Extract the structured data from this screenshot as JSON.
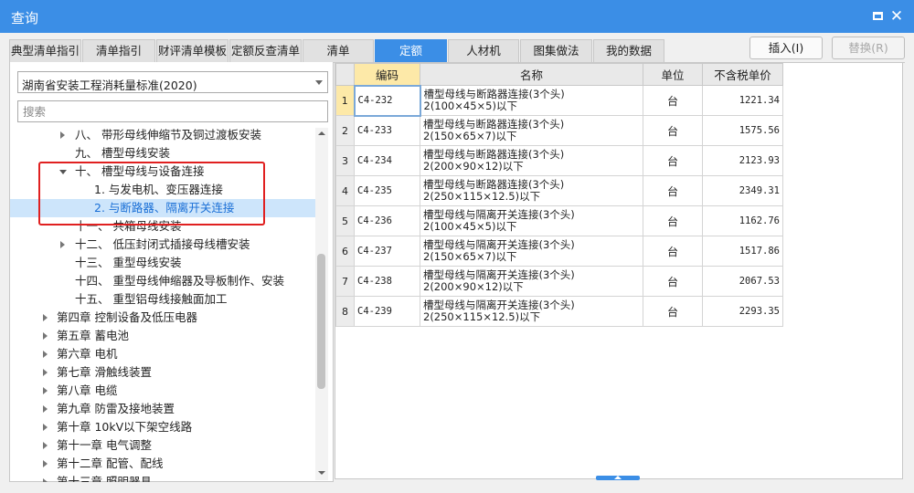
{
  "window": {
    "title": "查询"
  },
  "tabs": [
    {
      "label": "典型清单指引",
      "active": false
    },
    {
      "label": "清单指引",
      "active": false
    },
    {
      "label": "财评清单模板",
      "active": false
    },
    {
      "label": "定额反查清单",
      "active": false
    },
    {
      "label": "清单",
      "active": false
    },
    {
      "label": "定额",
      "active": true
    },
    {
      "label": "人材机",
      "active": false
    },
    {
      "label": "图集做法",
      "active": false
    },
    {
      "label": "我的数据",
      "active": false
    }
  ],
  "actions": {
    "insert": "插入(I)",
    "replace": "替换(R)"
  },
  "standard": {
    "selected": "湖南省安装工程消耗量标准(2020)"
  },
  "search": {
    "placeholder": "搜索"
  },
  "tree": [
    {
      "label": "八、 带形母线伸缩节及铜过渡板安装",
      "level": 2,
      "arrow": "right"
    },
    {
      "label": "九、 槽型母线安装",
      "level": 2,
      "arrow": ""
    },
    {
      "label": "十、 槽型母线与设备连接",
      "level": 2,
      "arrow": "down"
    },
    {
      "label": "1. 与发电机、变压器连接",
      "level": 3,
      "arrow": ""
    },
    {
      "label": "2. 与断路器、隔离开关连接",
      "level": 3,
      "arrow": "",
      "selected": true
    },
    {
      "label": "十一、 共箱母线安装",
      "level": 2,
      "arrow": ""
    },
    {
      "label": "十二、 低压封闭式插接母线槽安装",
      "level": 2,
      "arrow": "right"
    },
    {
      "label": "十三、 重型母线安装",
      "level": 2,
      "arrow": ""
    },
    {
      "label": "十四、 重型母线伸缩器及导板制作、安装",
      "level": 2,
      "arrow": ""
    },
    {
      "label": "十五、 重型铝母线接触面加工",
      "level": 2,
      "arrow": ""
    },
    {
      "label": "第四章 控制设备及低压电器",
      "level": 1,
      "arrow": "right"
    },
    {
      "label": "第五章 蓄电池",
      "level": 1,
      "arrow": "right"
    },
    {
      "label": "第六章 电机",
      "level": 1,
      "arrow": "right"
    },
    {
      "label": "第七章 滑触线装置",
      "level": 1,
      "arrow": "right"
    },
    {
      "label": "第八章 电缆",
      "level": 1,
      "arrow": "right"
    },
    {
      "label": "第九章 防雷及接地装置",
      "level": 1,
      "arrow": "right"
    },
    {
      "label": "第十章 10kV以下架空线路",
      "level": 1,
      "arrow": "right"
    },
    {
      "label": "第十一章 电气调整",
      "level": 1,
      "arrow": "right"
    },
    {
      "label": "第十二章 配管、配线",
      "level": 1,
      "arrow": "right"
    },
    {
      "label": "第十三章 照明器具",
      "level": 1,
      "arrow": "right"
    }
  ],
  "grid": {
    "headers": [
      "编码",
      "名称",
      "单位",
      "不含税单价"
    ],
    "rows": [
      {
        "no": "1",
        "code": "C4-232",
        "name1": "槽型母线与断路器连接(3个头)",
        "name2": "2(100×45×5)以下",
        "unit": "台",
        "price": "1221.34"
      },
      {
        "no": "2",
        "code": "C4-233",
        "name1": "槽型母线与断路器连接(3个头)",
        "name2": "2(150×65×7)以下",
        "unit": "台",
        "price": "1575.56"
      },
      {
        "no": "3",
        "code": "C4-234",
        "name1": "槽型母线与断路器连接(3个头)",
        "name2": "2(200×90×12)以下",
        "unit": "台",
        "price": "2123.93"
      },
      {
        "no": "4",
        "code": "C4-235",
        "name1": "槽型母线与断路器连接(3个头)",
        "name2": "2(250×115×12.5)以下",
        "unit": "台",
        "price": "2349.31"
      },
      {
        "no": "5",
        "code": "C4-236",
        "name1": "槽型母线与隔离开关连接(3个头)",
        "name2": "2(100×45×5)以下",
        "unit": "台",
        "price": "1162.76"
      },
      {
        "no": "6",
        "code": "C4-237",
        "name1": "槽型母线与隔离开关连接(3个头)",
        "name2": "2(150×65×7)以下",
        "unit": "台",
        "price": "1517.86"
      },
      {
        "no": "7",
        "code": "C4-238",
        "name1": "槽型母线与隔离开关连接(3个头)",
        "name2": "2(200×90×12)以下",
        "unit": "台",
        "price": "2067.53"
      },
      {
        "no": "8",
        "code": "C4-239",
        "name1": "槽型母线与隔离开关连接(3个头)",
        "name2": "2(250×115×12.5)以下",
        "unit": "台",
        "price": "2293.35"
      }
    ]
  },
  "colors": {
    "accent": "#3b8ee6",
    "selected_row": "#cde5fb",
    "highlight_box": "#e02020",
    "header_active": "#fde9a8"
  }
}
